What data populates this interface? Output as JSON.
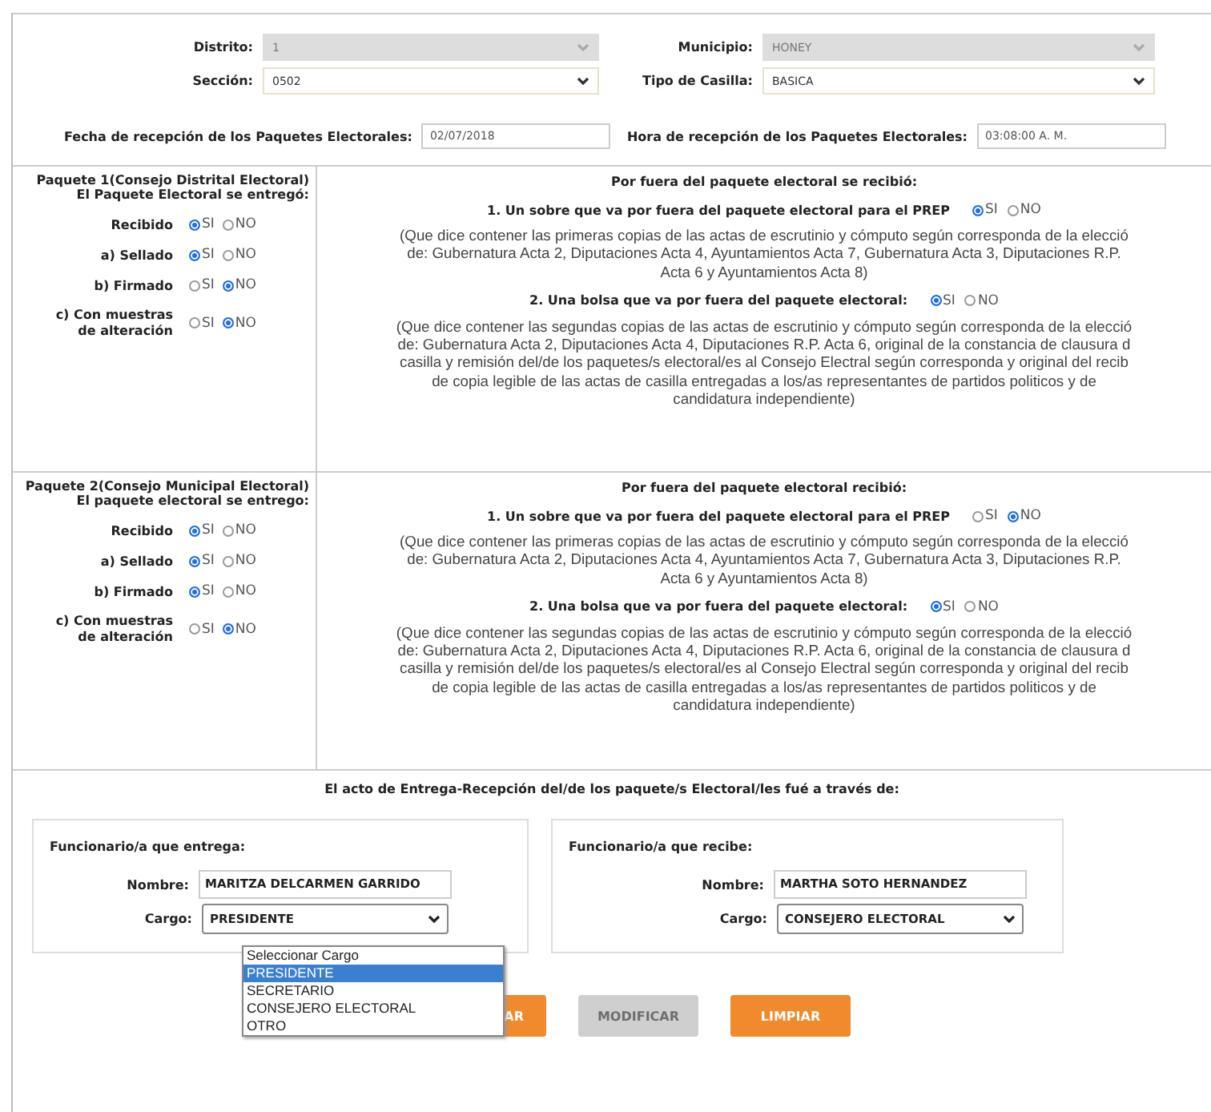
{
  "header": [
    {
      "label": "Distrito:",
      "value": "1",
      "disabled": true
    },
    {
      "label": "Municipio:",
      "value": "HONEY",
      "disabled": true
    },
    {
      "label": "Sección:",
      "value": "0502",
      "disabled": false
    },
    {
      "label": "Tipo de Casilla:",
      "value": "BASICA",
      "disabled": false
    }
  ],
  "reception": [
    {
      "label": "Fecha de recepción de los Paquetes Electorales:",
      "value": "02/07/2018"
    },
    {
      "label": "Hora de recepción de los Paquetes Electorales:",
      "value": "03:08:00 A. M."
    }
  ],
  "paquetes": [
    {
      "title": "Paquete 1(Consejo Distrital Electoral)\nEl Paquete Electoral se entregó:",
      "checks": [
        {
          "label": "Recibido",
          "options": [
            {
              "label": "SI",
              "selected": true
            },
            {
              "label": "NO",
              "selected": false
            }
          ]
        },
        {
          "label": "a) Sellado",
          "options": [
            {
              "label": "SI",
              "selected": true
            },
            {
              "label": "NO",
              "selected": false
            }
          ]
        },
        {
          "label": "b) Firmado",
          "options": [
            {
              "label": "SI",
              "selected": false
            },
            {
              "label": "NO",
              "selected": true
            }
          ]
        },
        {
          "label": "c) Con muestras\nde alteración",
          "options": [
            {
              "label": "SI",
              "selected": false
            },
            {
              "label": "NO",
              "selected": true
            }
          ]
        }
      ],
      "heading": "Por fuera del paquete electoral se recibió:",
      "items": [
        {
          "question": "1. Un sobre que va por fuera del paquete electoral para el PREP",
          "options": [
            {
              "label": "SI",
              "selected": true
            },
            {
              "label": "NO",
              "selected": false
            }
          ],
          "note": "(Que dice contener las primeras copias de las actas de escrutinio y cómputo según corresponda de la elecció\nde: Gubernatura Acta 2, Diputaciones Acta 4, Ayuntamientos Acta 7, Gubernatura Acta 3, Diputaciones R.P.\nActa 6 y Ayuntamientos Acta 8)"
        },
        {
          "question": "2. Una bolsa que va por fuera del paquete electoral:",
          "options": [
            {
              "label": "SI",
              "selected": true
            },
            {
              "label": "NO",
              "selected": false
            }
          ],
          "note": "(Que dice contener las segundas copias de las actas de escrutinio y cómputo según corresponda de la elecció\nde: Gubernatura Acta 2, Diputaciones Acta 4, Diputaciones R.P. Acta 6, original de la constancia de clausura d\ncasilla y remisión del/de los paquetes/s electoral/es al Consejo Electral según corresponda y original del recib\nde copia legible de las actas de casilla entregadas a los/as representantes de partidos politicos y de\ncandidatura independiente)"
        }
      ]
    },
    {
      "title": "Paquete 2(Consejo Municipal Electoral)\nEl paquete electoral se entrego:",
      "checks": [
        {
          "label": "Recibido",
          "options": [
            {
              "label": "SI",
              "selected": true
            },
            {
              "label": "NO",
              "selected": false
            }
          ]
        },
        {
          "label": "a) Sellado",
          "options": [
            {
              "label": "SI",
              "selected": true
            },
            {
              "label": "NO",
              "selected": false
            }
          ]
        },
        {
          "label": "b) Firmado",
          "options": [
            {
              "label": "SI",
              "selected": true
            },
            {
              "label": "NO",
              "selected": false
            }
          ]
        },
        {
          "label": "c) Con muestras\nde alteración",
          "options": [
            {
              "label": "SI",
              "selected": false
            },
            {
              "label": "NO",
              "selected": true
            }
          ]
        }
      ],
      "heading": "Por fuera del paquete electoral recibió:",
      "items": [
        {
          "question": "1. Un sobre que va por fuera del paquete electoral para el PREP",
          "options": [
            {
              "label": "SI",
              "selected": false
            },
            {
              "label": "NO",
              "selected": true
            }
          ],
          "note": "(Que dice contener las primeras copias de las actas de escrutinio y cómputo según corresponda de la elecció\nde: Gubernatura Acta 2, Diputaciones Acta 4, Ayuntamientos Acta 7, Gubernatura Acta 3, Diputaciones R.P.\nActa 6 y Ayuntamientos Acta 8)"
        },
        {
          "question": "2. Una bolsa que va por fuera del paquete electoral:",
          "options": [
            {
              "label": "SI",
              "selected": true
            },
            {
              "label": "NO",
              "selected": false
            }
          ],
          "note": "(Que dice contener las segundas copias de las actas de escrutinio y cómputo según corresponda de la elecció\nde: Gubernatura Acta 2, Diputaciones Acta 4, Diputaciones R.P. Acta 6, original de la constancia de clausura d\ncasilla y remisión del/de los paquetes/s electoral/es al Consejo Electral según corresponda y original del recib\nde copia legible de las actas de casilla entregadas a los/as representantes de partidos politicos y de\ncandidatura independiente)"
        }
      ]
    }
  ],
  "entrega": {
    "heading": "El acto de Entrega-Recepción del/de los paquete/s Electoral/les fué a través de:",
    "funcionarios": [
      {
        "title": "Funcionario/a que entrega:",
        "nombre_label": "Nombre:",
        "nombre": "MARITZA DELCARMEN GARRIDO",
        "cargo_label": "Cargo:",
        "cargo": "PRESIDENTE"
      },
      {
        "title": "Funcionario/a que recibe:",
        "nombre_label": "Nombre:",
        "nombre": "MARTHA SOTO HERNANDEZ",
        "cargo_label": "Cargo:",
        "cargo": "CONSEJERO ELECTORAL"
      }
    ],
    "dropdown": [
      {
        "label": "Seleccionar Cargo",
        "selected": false
      },
      {
        "label": "PRESIDENTE",
        "selected": true
      },
      {
        "label": "SECRETARIO",
        "selected": false
      },
      {
        "label": "CONSEJERO ELECTORAL",
        "selected": false
      },
      {
        "label": "OTRO",
        "selected": false
      }
    ],
    "buttons": [
      {
        "label": "AR",
        "disabled": false
      },
      {
        "label": "MODIFICAR",
        "disabled": true
      },
      {
        "label": "LIMPIAR",
        "disabled": false
      }
    ]
  }
}
